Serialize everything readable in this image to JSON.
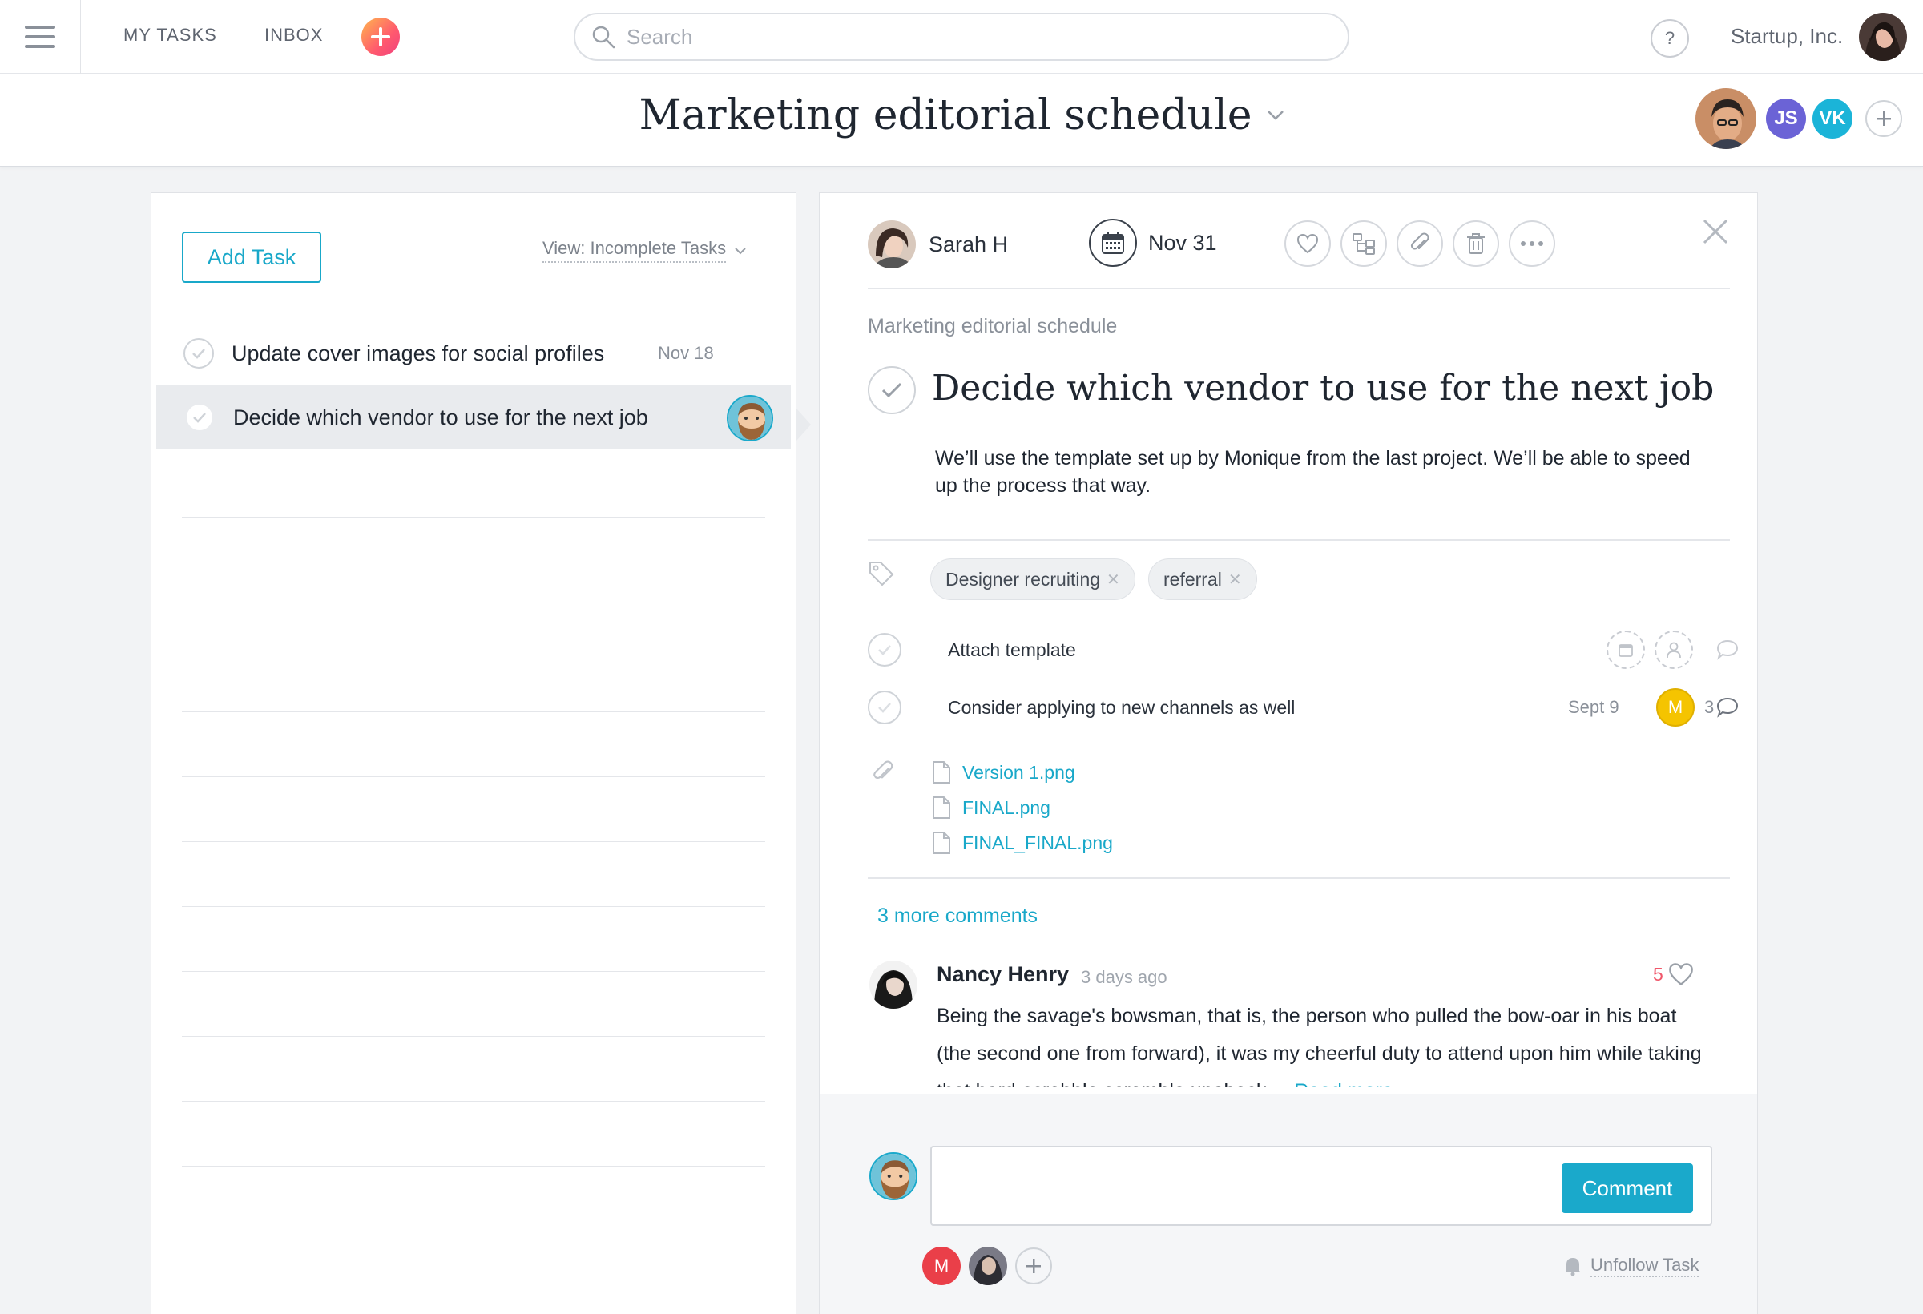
{
  "topbar": {
    "nav": [
      "MY TASKS",
      "INBOX"
    ],
    "search_placeholder": "Search",
    "help": "?",
    "org": "Startup, Inc."
  },
  "project": {
    "title": "Marketing editorial schedule",
    "members": [
      {
        "initials": "JS",
        "color": "#6b63d6"
      },
      {
        "initials": "VK",
        "color": "#1bb4d8"
      }
    ]
  },
  "task_list": {
    "add_task_label": "Add Task",
    "view_filter": "View: Incomplete Tasks",
    "tasks": [
      {
        "name": "Update cover images for social profiles",
        "date": "Nov 18"
      },
      {
        "name": "Decide which vendor to use for the next job",
        "date": ""
      }
    ]
  },
  "detail": {
    "assignee": "Sarah H",
    "due": "Nov 31",
    "breadcrumb": "Marketing editorial schedule",
    "title": "Decide which vendor to use for the next job",
    "description": "We’ll use the template set up by Monique from the last project. We’ll be able to speed up the process that way.",
    "tags": [
      "Designer recruiting",
      "referral"
    ],
    "subtasks": [
      {
        "name": "Attach template",
        "date": "",
        "assignee_initial": "",
        "comment_count": ""
      },
      {
        "name": "Consider applying to new channels as well",
        "date": "Sept 9",
        "assignee_initial": "M",
        "comment_count": "3"
      }
    ],
    "attachments": [
      "Version 1.png",
      "FINAL.png",
      "FINAL_FINAL.png"
    ],
    "more_comments": "3 more comments",
    "comment": {
      "author": "Nancy Henry",
      "time": "3 days ago",
      "likes": "5",
      "body": "Being the savage's bowsman, that is, the person who pulled the bow-oar in his boat (the second one from forward), it was my cheerful duty to attend upon him while taking that hard-scrabble scramble upoback....",
      "read_more": "Read more"
    },
    "composer": {
      "button": "Comment",
      "followers": [
        {
          "initial": "M",
          "color": "#ea3f49"
        }
      ],
      "unfollow": "Unfollow Task"
    }
  },
  "colors": {
    "accent": "#19a8c9",
    "like": "#f0576a",
    "subtask_assignee": "#f5c400"
  }
}
